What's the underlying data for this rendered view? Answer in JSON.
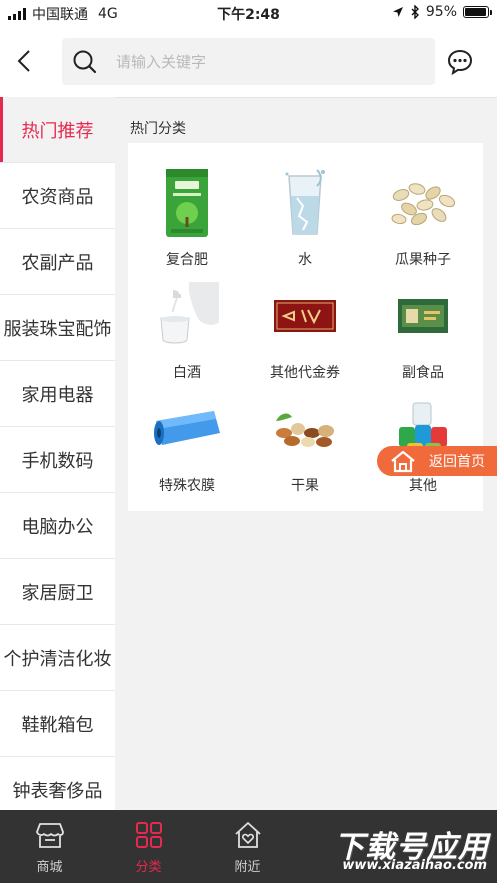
{
  "status_bar": {
    "carrier": "中国联通",
    "network": "4G",
    "time": "下午2:48",
    "battery": "95%",
    "battery_level": 0.95
  },
  "header": {
    "search_placeholder": "请输入关键字"
  },
  "sidebar": {
    "items": [
      {
        "label": "热门推荐"
      },
      {
        "label": "农资商品"
      },
      {
        "label": "农副产品"
      },
      {
        "label": "服装珠宝配饰"
      },
      {
        "label": "家用电器"
      },
      {
        "label": "手机数码"
      },
      {
        "label": "电脑办公"
      },
      {
        "label": "家居厨卫"
      },
      {
        "label": "个护清洁化妆"
      },
      {
        "label": "鞋靴箱包"
      },
      {
        "label": "钟表奢侈品"
      }
    ],
    "active_index": 0
  },
  "main": {
    "section_title": "热门分类",
    "items": [
      {
        "label": "复合肥",
        "icon": "fertilizer-bag-image"
      },
      {
        "label": "水",
        "icon": "water-glass-image"
      },
      {
        "label": "瓜果种子",
        "icon": "melon-seeds-image"
      },
      {
        "label": "白酒",
        "icon": "baijiu-image"
      },
      {
        "label": "其他代金券",
        "icon": "voucher-image"
      },
      {
        "label": "副食品",
        "icon": "food-box-image"
      },
      {
        "label": "特殊农膜",
        "icon": "agri-film-image"
      },
      {
        "label": "干果",
        "icon": "dried-nuts-image"
      },
      {
        "label": "其他",
        "icon": "yarn-spools-image"
      }
    ]
  },
  "float_button": {
    "label": "返回首页"
  },
  "tabbar": {
    "tabs": [
      {
        "label": "商城"
      },
      {
        "label": "分类"
      },
      {
        "label": "附近"
      }
    ],
    "active_index": 1
  },
  "watermark": {
    "title": "下载号应用",
    "url": "www.xiazaihao.com"
  },
  "colors": {
    "accent": "#e6294e",
    "float_button": "#f06a3c",
    "tabbar_bg": "#333333"
  }
}
